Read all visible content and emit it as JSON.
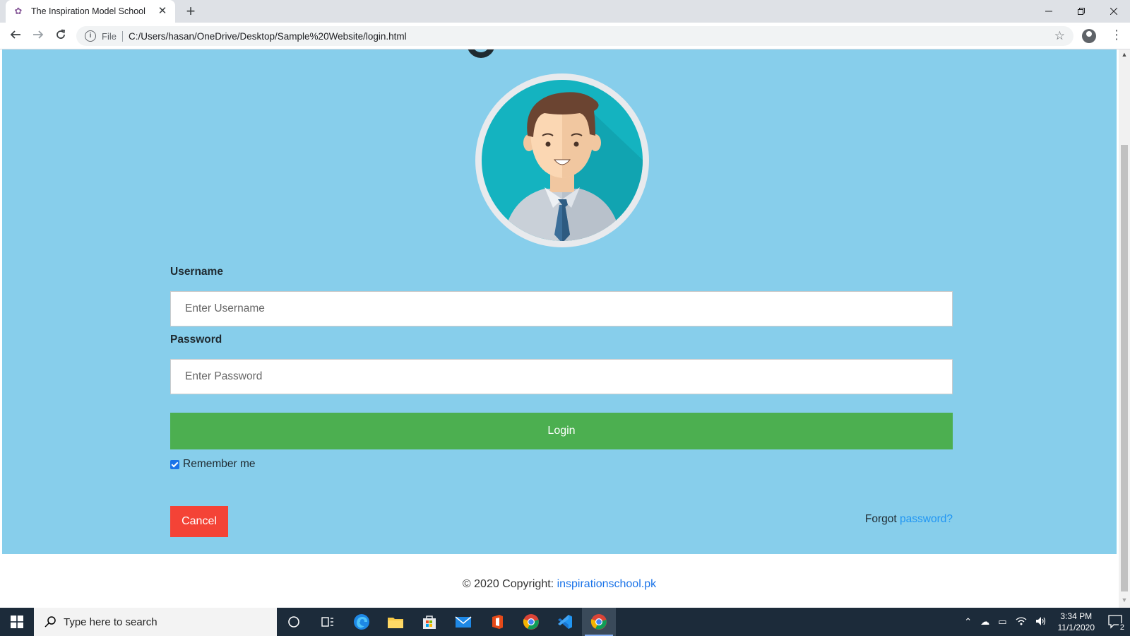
{
  "browser": {
    "tab_title": "The Inspiration Model School",
    "scheme_label": "File",
    "url": "C:/Users/hasan/OneDrive/Desktop/Sample%20Website/login.html"
  },
  "form": {
    "username_label": "Username",
    "username_placeholder": "Enter Username",
    "password_label": "Password",
    "password_placeholder": "Enter Password",
    "login_label": "Login",
    "remember_label": "Remember me",
    "remember_checked": true,
    "cancel_label": "Cancel",
    "forgot_text": "Forgot",
    "forgot_link": "password?"
  },
  "footer": {
    "copyright": "© 2020 Copyright:",
    "site_link": "inspirationschool.pk"
  },
  "taskbar": {
    "search_placeholder": "Type here to search",
    "time": "3:34 PM",
    "date": "11/1/2020",
    "notification_count": "2"
  },
  "colors": {
    "panel_bg": "#87ceeb",
    "login_button": "#4caf50",
    "cancel_button": "#f44336",
    "link": "#2196f3"
  }
}
